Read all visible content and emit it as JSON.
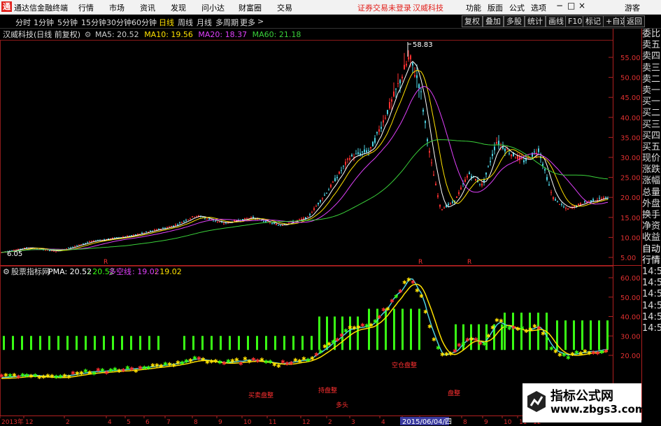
{
  "menubar": {
    "app_title": "通达信金融终端",
    "items": [
      "行情",
      "市场",
      "资讯",
      "发现",
      "问小达",
      "财富圈",
      "交易"
    ],
    "login_notice": "证券交易未登录",
    "stock_name": "汉威科技",
    "right_items": [
      "功能",
      "版面",
      "公式",
      "选项"
    ],
    "user": "游客",
    "window_controls": [
      "−",
      "□",
      "×"
    ]
  },
  "toolbar": {
    "periods": [
      "分时",
      "1分钟",
      "5分钟",
      "15分钟",
      "30分钟",
      "60分钟",
      "日线",
      "周线",
      "月线",
      "多周期",
      "更多"
    ],
    "active_period": "日线",
    "right_buttons": [
      "复权",
      "叠加",
      "多股",
      "统计",
      "画线",
      "F10",
      "标记",
      "+自选",
      "返回"
    ]
  },
  "main_chart": {
    "title": "汉威科技(日线 前复权)",
    "indicators": [
      {
        "label": "MA5: 20.52",
        "color": "#ffffff"
      },
      {
        "label": "MA10: 19.56",
        "color": "#ffe100"
      },
      {
        "label": "MA20: 18.37",
        "color": "#e040fb"
      },
      {
        "label": "MA60: 21.18",
        "color": "#3ad13a"
      }
    ],
    "peak_label": "58.83",
    "low_label": "6.05",
    "y_ticks": [
      "55.00",
      "50.00",
      "45.00",
      "40.00",
      "35.00",
      "30.00",
      "25.00",
      "20.00",
      "15.00",
      "10.00",
      "5.00"
    ],
    "markers": [
      "R",
      "R",
      "R"
    ]
  },
  "sub_chart": {
    "title": "股票指标网",
    "pma_label": "PMA: 20.52",
    "val1": ": 20.52",
    "duokong_label": "多空线",
    "duokong_val": ": 19.02",
    "val3": ": 19.02",
    "y_ticks": [
      "60.00",
      "50.00",
      "40.00",
      "30.00",
      "20.00"
    ],
    "annotations": [
      "买卖盘整",
      "持盘整",
      "空仓盘整",
      "盘整",
      "多头"
    ]
  },
  "x_axis": {
    "labels": [
      "2013年",
      "12",
      "2",
      "4",
      "5",
      "6",
      "7",
      "8",
      "9",
      "10",
      "11",
      "12",
      "2",
      "3",
      "4",
      "5",
      "6",
      "8",
      "9",
      "10",
      "11",
      "12"
    ],
    "cursor_date": "2015/06/04/四"
  },
  "side_panel": {
    "items": [
      "委比",
      "卖五",
      "卖四",
      "卖三",
      "卖二",
      "卖一",
      "买一",
      "买二",
      "买三",
      "买四",
      "买五",
      "现价",
      "涨跌",
      "涨幅",
      "总量",
      "外盘",
      "换手",
      "净资",
      "收益",
      "自动",
      "行情",
      "14:50",
      "14:50",
      "14:50",
      "14:50",
      "14:50",
      "14:50"
    ]
  },
  "watermark": {
    "line1": "指标公式网",
    "line2": "www.zbgs3.com"
  },
  "colors": {
    "up": "#ff3030",
    "down": "#4dd0e1",
    "bars": "#39ff14",
    "ma5": "#ffffff",
    "ma10": "#ffe100",
    "ma20": "#e040fb",
    "ma60": "#3ad13a"
  }
}
